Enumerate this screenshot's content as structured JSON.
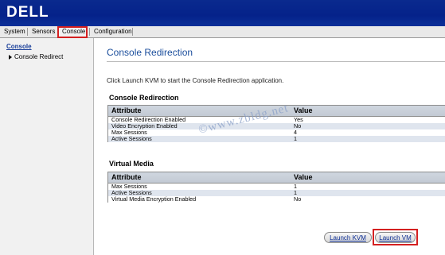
{
  "header": {
    "logo_text": "DELL",
    "bg_color": "#0a2a8e"
  },
  "tabs": [
    {
      "label": "System"
    },
    {
      "label": "Sensors"
    },
    {
      "label": "Console",
      "active": true
    },
    {
      "label": "Configuration"
    }
  ],
  "sidebar": {
    "title": "Console",
    "items": [
      {
        "label": "Console Redirect"
      }
    ]
  },
  "main": {
    "title": "Console Redirection",
    "intro": "Click Launch KVM to start the Console Redirection application.",
    "console_section": {
      "title": "Console Redirection",
      "headers": {
        "attribute": "Attribute",
        "value": "Value"
      },
      "rows": [
        {
          "attribute": "Console Redirection Enabled",
          "value": "Yes"
        },
        {
          "attribute": "Video Encryption Enabled",
          "value": "No"
        },
        {
          "attribute": "Max Sessions",
          "value": "4"
        },
        {
          "attribute": "Active Sessions",
          "value": "1"
        }
      ]
    },
    "media_section": {
      "title": "Virtual Media",
      "headers": {
        "attribute": "Attribute",
        "value": "Value"
      },
      "rows": [
        {
          "attribute": "Max Sessions",
          "value": "1"
        },
        {
          "attribute": "Active Sessions",
          "value": "1"
        },
        {
          "attribute": "Virtual Media Encryption Enabled",
          "value": "No"
        }
      ]
    },
    "buttons": {
      "launch_kvm": "Launch KVM",
      "launch_vm": "Launch VM"
    }
  },
  "watermark": "©www.zbldg.net",
  "colors": {
    "highlight": "#d42020",
    "link": "#1b4e9c",
    "row_alt": "#dfe5ee"
  }
}
